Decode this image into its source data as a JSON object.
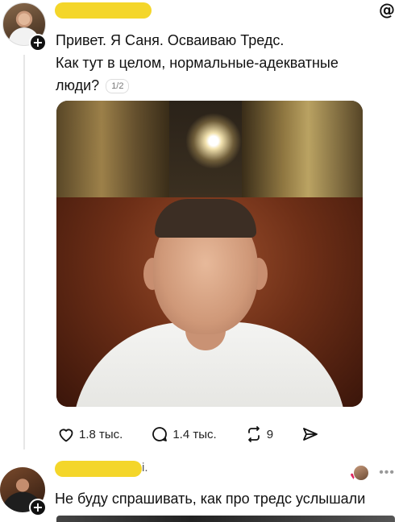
{
  "post": {
    "author_name": "",
    "text_line1": "Привет. Я Саня. Осваиваю Тредс.",
    "text_line2": "Как тут в целом, нормальные-адекватные",
    "text_line3": "люди?",
    "thread_counter": "1/2",
    "stats": {
      "likes": "1.8 тыс.",
      "replies": "1.4 тыс.",
      "reposts": "9"
    }
  },
  "reply": {
    "author_name_tail": "і.",
    "text": "Не буду спрашивать, как про тредс услышали",
    "more": "•••"
  },
  "icons": {
    "app_logo": "threads-logo-icon",
    "like": "heart-icon",
    "reply": "comment-bubble-icon",
    "repost": "repost-icon",
    "share": "send-icon",
    "follow": "plus-icon"
  },
  "colors": {
    "redaction": "#f4d62a",
    "like_heart": "#e0245e"
  }
}
